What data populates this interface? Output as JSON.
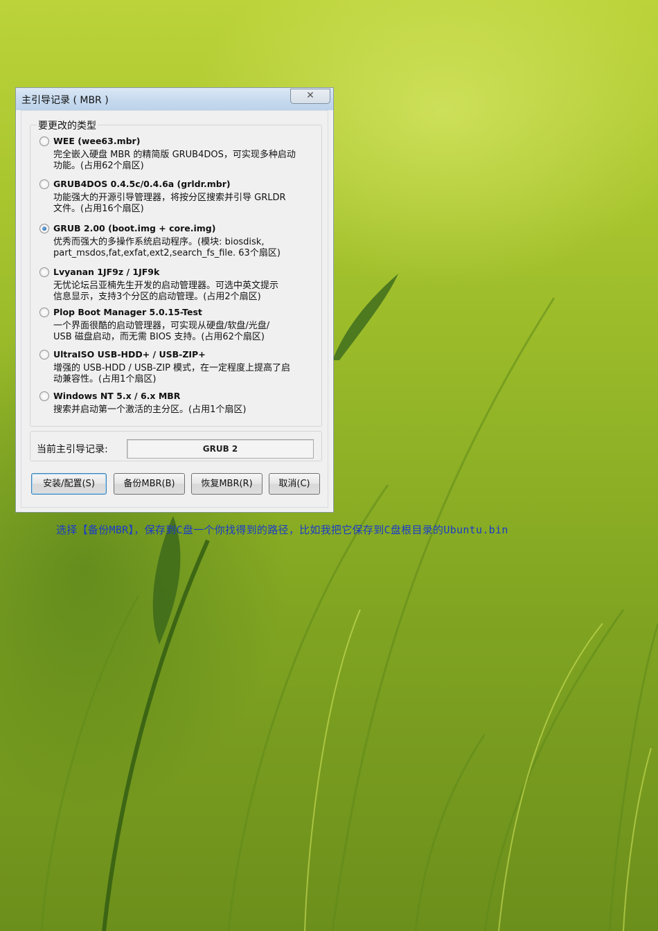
{
  "dialog": {
    "title": "主引导记录 ( MBR )",
    "close_icon": "close-icon",
    "group_title": "要更改的类型",
    "options": [
      {
        "title": "WEE (wee63.mbr)",
        "desc_lines": [
          "完全嵌入硬盘 MBR 的精简版 GRUB4DOS，可实现多种启动",
          "功能。(占用62个扇区)"
        ],
        "checked": false
      },
      {
        "title": "GRUB4DOS 0.4.5c/0.4.6a (grldr.mbr)",
        "desc_lines": [
          "功能强大的开源引导管理器，将按分区搜索并引导 GRLDR",
          "文件。(占用16个扇区)"
        ],
        "checked": false
      },
      {
        "title": "GRUB 2.00 (boot.img + core.img)",
        "desc_lines": [
          "优秀而强大的多操作系统启动程序。(模块: biosdisk,",
          "part_msdos,fat,exfat,ext2,search_fs_file. 63个扇区)"
        ],
        "checked": true
      },
      {
        "title": "Lvyanan 1JF9z / 1JF9k",
        "desc_lines": [
          "无忧论坛吕亚楠先生开发的启动管理器。可选中英文提示",
          "信息显示，支持3个分区的启动管理。(占用2个扇区)"
        ],
        "checked": false
      },
      {
        "title": "Plop Boot Manager 5.0.15-Test",
        "desc_lines": [
          "一个界面很酷的启动管理器，可实现从硬盘/软盘/光盘/",
          "USB 磁盘启动，而无需 BIOS 支持。(占用62个扇区)"
        ],
        "checked": false
      },
      {
        "title": "UltraISO USB-HDD+ / USB-ZIP+",
        "desc_lines": [
          "增强的 USB-HDD / USB-ZIP 模式，在一定程度上提高了启",
          "动兼容性。(占用1个扇区)"
        ],
        "checked": false
      },
      {
        "title": "Windows NT 5.x / 6.x MBR",
        "desc_lines": [
          "搜索并启动第一个激活的主分区。(占用1个扇区)"
        ],
        "checked": false
      }
    ],
    "current_label": "当前主引导记录:",
    "current_value": "GRUB 2",
    "buttons": {
      "install": "安装/配置(S)",
      "backup": "备份MBR(B)",
      "restore": "恢复MBR(R)",
      "cancel": "取消(C)"
    }
  },
  "caption": "选择【备份MBR】，保存到C盘一个你找得到的路径，比如我把它保存到C盘根目录的Ubuntu.bin",
  "colors": {
    "caption": "#1a3cc8",
    "wallpaper": "#9ab82a",
    "titlebar": "#c8dbef"
  }
}
